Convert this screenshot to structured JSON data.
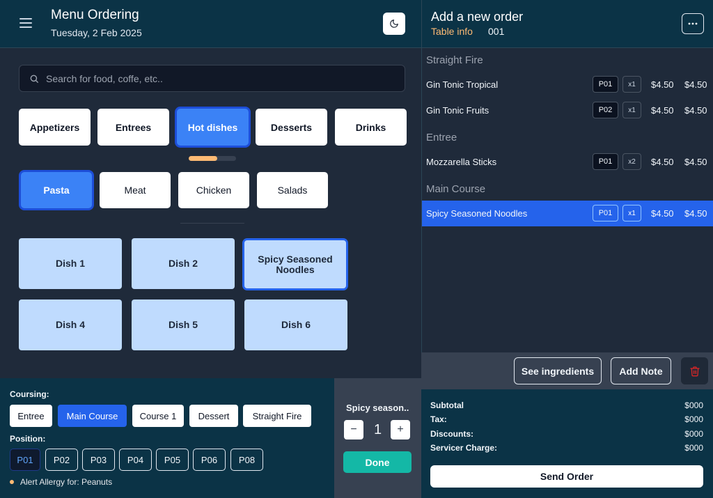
{
  "header": {
    "title": "Menu Ordering",
    "date": "Tuesday, 2 Feb 2025"
  },
  "search": {
    "placeholder": "Search for food, coffe, etc.."
  },
  "categories": [
    "Appetizers",
    "Entrees",
    "Hot dishes",
    "Desserts",
    "Drinks"
  ],
  "active_category": "Hot dishes",
  "category_scroll_progress": 0.6,
  "subcategories": [
    "Pasta",
    "Meat",
    "Chicken",
    "Salads"
  ],
  "active_subcategory": "Pasta",
  "dishes": [
    "Dish 1",
    "Dish 2",
    "Spicy Seasoned Noodles",
    "Dish 4",
    "Dish 5",
    "Dish 6"
  ],
  "selected_dish": "Spicy Seasoned Noodles",
  "coursing": {
    "label": "Coursing:",
    "options": [
      "Entree",
      "Main Course",
      "Course 1",
      "Dessert",
      "Straight Fire"
    ],
    "active": "Main Course"
  },
  "position": {
    "label": "Position:",
    "options": [
      "P01",
      "P02",
      "P03",
      "P04",
      "P05",
      "P06",
      "P08"
    ],
    "active": "P01"
  },
  "alert": "Alert Allergy for: Peanuts",
  "quantity": {
    "item_name": "Spicy season..",
    "value": "1",
    "minus": "−",
    "plus": "+",
    "done_label": "Done"
  },
  "order": {
    "title": "Add a new order",
    "table_label": "Table info",
    "table_number": "001",
    "groups": [
      {
        "name": "Straight Fire",
        "items": [
          {
            "name": "Gin Tonic Tropical",
            "pos": "P01",
            "qty": "x1",
            "price": "$4.50",
            "total": "$4.50"
          },
          {
            "name": "Gin Tonic Fruits",
            "pos": "P02",
            "qty": "x1",
            "price": "$4.50",
            "total": "$4.50"
          }
        ]
      },
      {
        "name": "Entree",
        "items": [
          {
            "name": "Mozzarella Sticks",
            "pos": "P01",
            "qty": "x2",
            "price": "$4.50",
            "total": "$4.50"
          }
        ]
      },
      {
        "name": "Main Course",
        "items": [
          {
            "name": "Spicy Seasoned Noodles",
            "pos": "P01",
            "qty": "x1",
            "price": "$4.50",
            "total": "$4.50"
          }
        ]
      }
    ],
    "selected_item": "Spicy Seasoned Noodles"
  },
  "actions": {
    "see_ingredients": "See ingredients",
    "add_note": "Add Note"
  },
  "summary": {
    "subtotal_label": "Subtotal",
    "subtotal": "$000",
    "tax_label": "Tax:",
    "tax": "$000",
    "discounts_label": "Discounts:",
    "discounts": "$000",
    "service_label": "Servicer Charge:",
    "service": "$000",
    "send_label": "Send Order"
  },
  "colors": {
    "header_bg": "#0b3346",
    "accent_blue": "#3b82f6",
    "accent_orange": "#fdba74",
    "done_teal": "#14b8a6",
    "danger_red": "#dc2626"
  }
}
